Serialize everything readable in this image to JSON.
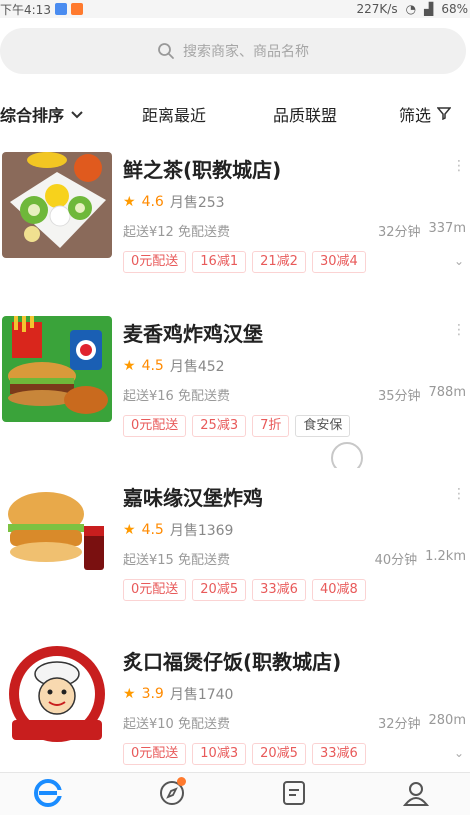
{
  "status_bar": {
    "time": "下午4:13",
    "speed": "227K/s",
    "battery": "68%"
  },
  "search": {
    "placeholder": "搜索商家、商品名称",
    "icon": "search-icon"
  },
  "sort_bar": {
    "items": [
      {
        "label": "综合排序",
        "icon": "chevron-down-icon"
      },
      {
        "label": "距离最近"
      },
      {
        "label": "品质联盟"
      },
      {
        "label": "筛选",
        "icon": "filter-icon"
      }
    ]
  },
  "shops": [
    {
      "name": "鲜之茶(职教城店)",
      "rating": "4.6",
      "monthly_sales": "月售253",
      "delivery": "起送¥12  免配送费",
      "time": "32分钟",
      "distance": "337m",
      "tags": [
        "0元配送",
        "16减1",
        "21减2",
        "30减4"
      ],
      "image": "fruit-platter-image"
    },
    {
      "name": "麦香鸡炸鸡汉堡",
      "rating": "4.5",
      "monthly_sales": "月售452",
      "delivery": "起送¥16  免配送费",
      "time": "35分钟",
      "distance": "788m",
      "tags": [
        "0元配送",
        "25减3",
        "7折"
      ],
      "badge": "食安保",
      "image": "burger-combo-image"
    },
    {
      "name": "嘉味缘汉堡炸鸡",
      "rating": "4.5",
      "monthly_sales": "月售1369",
      "delivery": "起送¥15  免配送费",
      "time": "40分钟",
      "distance": "1.2km",
      "tags": [
        "0元配送",
        "20减5",
        "33减6",
        "40减8"
      ],
      "image": "chicken-burger-image"
    },
    {
      "name": "炙口福煲仔饭(职教城店)",
      "rating": "3.9",
      "monthly_sales": "月售1740",
      "delivery": "起送¥10  免配送费",
      "time": "32分钟",
      "distance": "280m",
      "tags": [
        "0元配送",
        "10减3",
        "20减5",
        "33减6"
      ],
      "image": "chef-logo-image",
      "logo_text": "ZHI KOU FU",
      "logo_name": "炙口福"
    }
  ],
  "tabbar": {
    "tabs": [
      "home-icon",
      "discover-icon",
      "orders-icon",
      "profile-icon"
    ],
    "accent": "#1a8cff"
  }
}
